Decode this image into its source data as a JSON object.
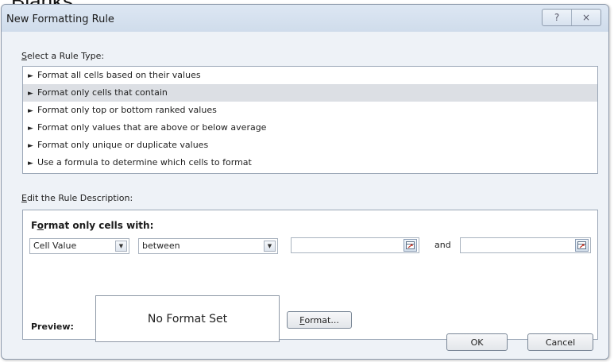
{
  "overlay_text": "Blanks:",
  "window": {
    "title": "New Formatting Rule",
    "help_button": "?",
    "close_button": "×"
  },
  "rule_type": {
    "label_accel": "S",
    "label_rest": "elect a Rule Type:",
    "items": [
      {
        "label": "Format all cells based on their values",
        "selected": false
      },
      {
        "label": "Format only cells that contain",
        "selected": true
      },
      {
        "label": "Format only top or bottom ranked values",
        "selected": false
      },
      {
        "label": "Format only values that are above or below average",
        "selected": false
      },
      {
        "label": "Format only unique or duplicate values",
        "selected": false
      },
      {
        "label": "Use a formula to determine which cells to format",
        "selected": false
      }
    ]
  },
  "description": {
    "label_accel": "E",
    "label_rest": "dit the Rule Description:",
    "heading_pre": "F",
    "heading_accel": "o",
    "heading_post": "rmat only cells with:",
    "condition_type": "Cell Value",
    "operator": "between",
    "value1": "",
    "value2": "",
    "and_label": "and",
    "preview_label": "Preview:",
    "preview_text": "No Format Set",
    "format_button_accel": "F",
    "format_button_rest": "ormat..."
  },
  "footer": {
    "ok": "OK",
    "cancel": "Cancel"
  },
  "colors": {
    "dialog_bg": "#eef2f7",
    "titlebar": "#cfdceb",
    "selected_row": "#dcdfe4",
    "ref_icon_red": "#c0392b"
  },
  "icons": [
    "help-icon",
    "close-icon",
    "dropdown-arrow-icon",
    "range-selector-icon"
  ]
}
